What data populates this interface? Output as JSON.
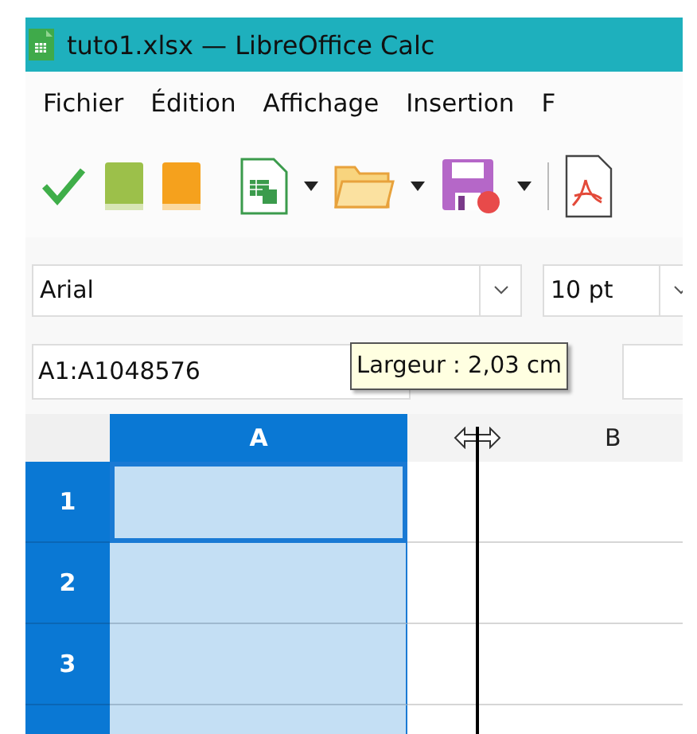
{
  "window": {
    "title": "tuto1.xlsx — LibreOffice Calc"
  },
  "menu": [
    {
      "label": "Fichier"
    },
    {
      "label": "Édition"
    },
    {
      "label": "Affichage"
    },
    {
      "label": "Insertion"
    },
    {
      "label": "F"
    }
  ],
  "formatting": {
    "font_name": "Arial",
    "font_size": "10 pt"
  },
  "formula_bar": {
    "name_box": "A1:A1048576"
  },
  "tooltip": "Largeur : 2,03 cm",
  "columns": [
    {
      "label": "A",
      "selected": true
    },
    {
      "label": "B",
      "selected": false
    }
  ],
  "rows": [
    {
      "label": "1",
      "selected": true
    },
    {
      "label": "2",
      "selected": true
    },
    {
      "label": "3",
      "selected": true
    },
    {
      "selected": true
    }
  ]
}
